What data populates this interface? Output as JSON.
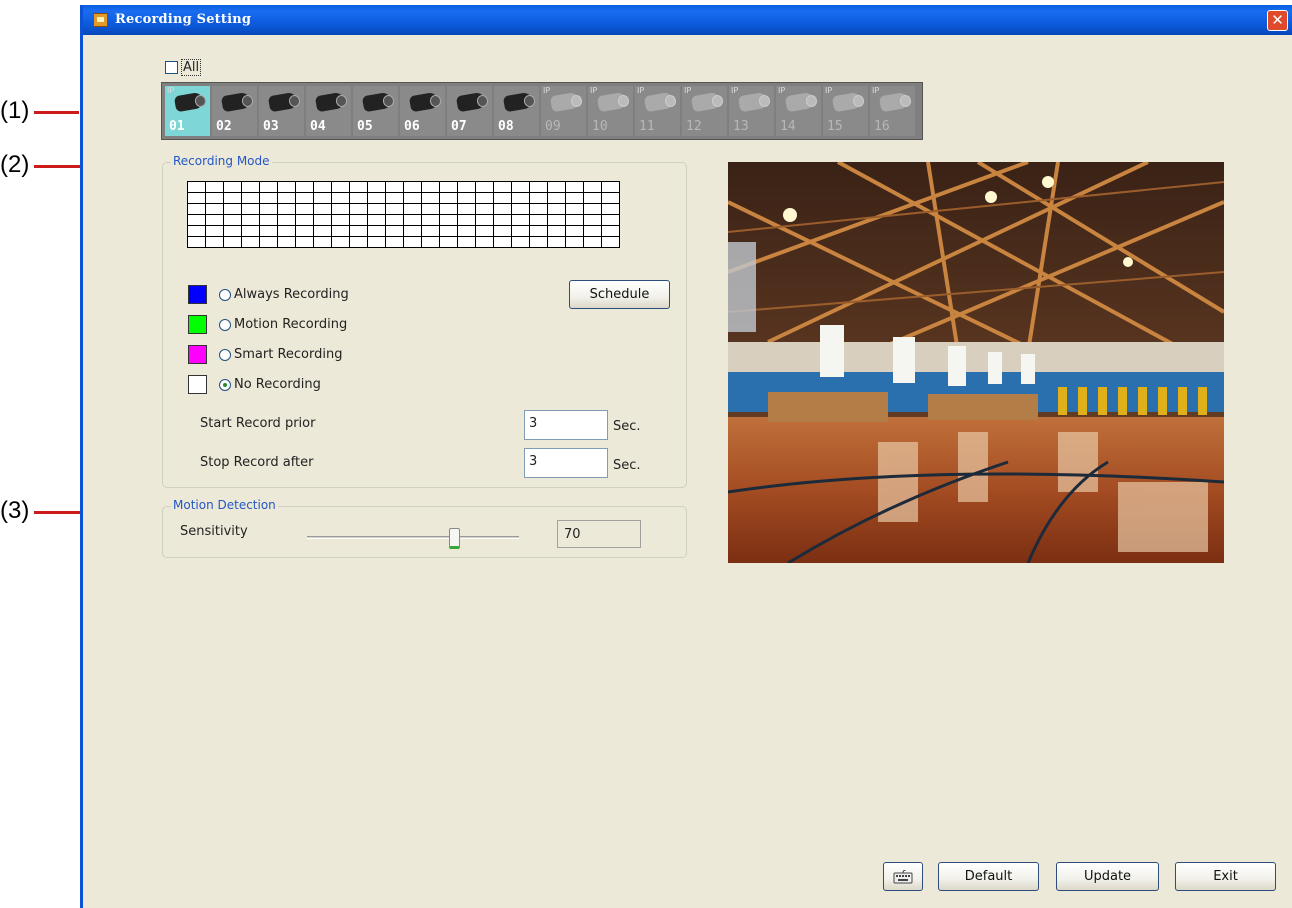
{
  "callouts": [
    "(1)",
    "(2)",
    "(3)"
  ],
  "window": {
    "title": "Recording Setting",
    "close_glyph": "✕"
  },
  "all_checkbox": {
    "label": "All",
    "checked": false
  },
  "cameras": [
    {
      "num": "01",
      "ip": "IP",
      "selected": true,
      "enabled": true
    },
    {
      "num": "02",
      "enabled": true
    },
    {
      "num": "03",
      "enabled": true
    },
    {
      "num": "04",
      "enabled": true
    },
    {
      "num": "05",
      "enabled": true
    },
    {
      "num": "06",
      "enabled": true
    },
    {
      "num": "07",
      "enabled": true
    },
    {
      "num": "08",
      "enabled": true
    },
    {
      "num": "09",
      "ip": "IP",
      "enabled": false
    },
    {
      "num": "10",
      "ip": "IP",
      "enabled": false
    },
    {
      "num": "11",
      "ip": "IP",
      "enabled": false
    },
    {
      "num": "12",
      "ip": "IP",
      "enabled": false
    },
    {
      "num": "13",
      "ip": "IP",
      "enabled": false
    },
    {
      "num": "14",
      "ip": "IP",
      "enabled": false
    },
    {
      "num": "15",
      "ip": "IP",
      "enabled": false
    },
    {
      "num": "16",
      "ip": "IP",
      "enabled": false
    }
  ],
  "recording_mode": {
    "legend": "Recording Mode",
    "schedule_button": "Schedule",
    "modes": [
      {
        "label": "Always Recording",
        "color": "#0000ff",
        "selected": false
      },
      {
        "label": "Motion Recording",
        "color": "#00ff00",
        "selected": false
      },
      {
        "label": "Smart Recording",
        "color": "#ff00ff",
        "selected": false
      },
      {
        "label": "No Recording",
        "color": "#ffffff",
        "selected": true
      }
    ],
    "start_prior": {
      "label": "Start Record prior",
      "value": "3",
      "unit": "Sec."
    },
    "stop_after": {
      "label": "Stop Record after",
      "value": "3",
      "unit": "Sec."
    }
  },
  "motion_detection": {
    "legend": "Motion Detection",
    "sensitivity_label": "Sensitivity",
    "sensitivity_value": "70",
    "sensitivity_level": 0.7
  },
  "footer": {
    "keyboard_icon": "keyboard-icon",
    "default_button": "Default",
    "update_button": "Update",
    "exit_button": "Exit"
  },
  "colors": {
    "title_bar": "#0a5fe0",
    "window_bg": "#ece9d8",
    "legend": "#2457c5",
    "callout_line": "#cc1b1b"
  }
}
